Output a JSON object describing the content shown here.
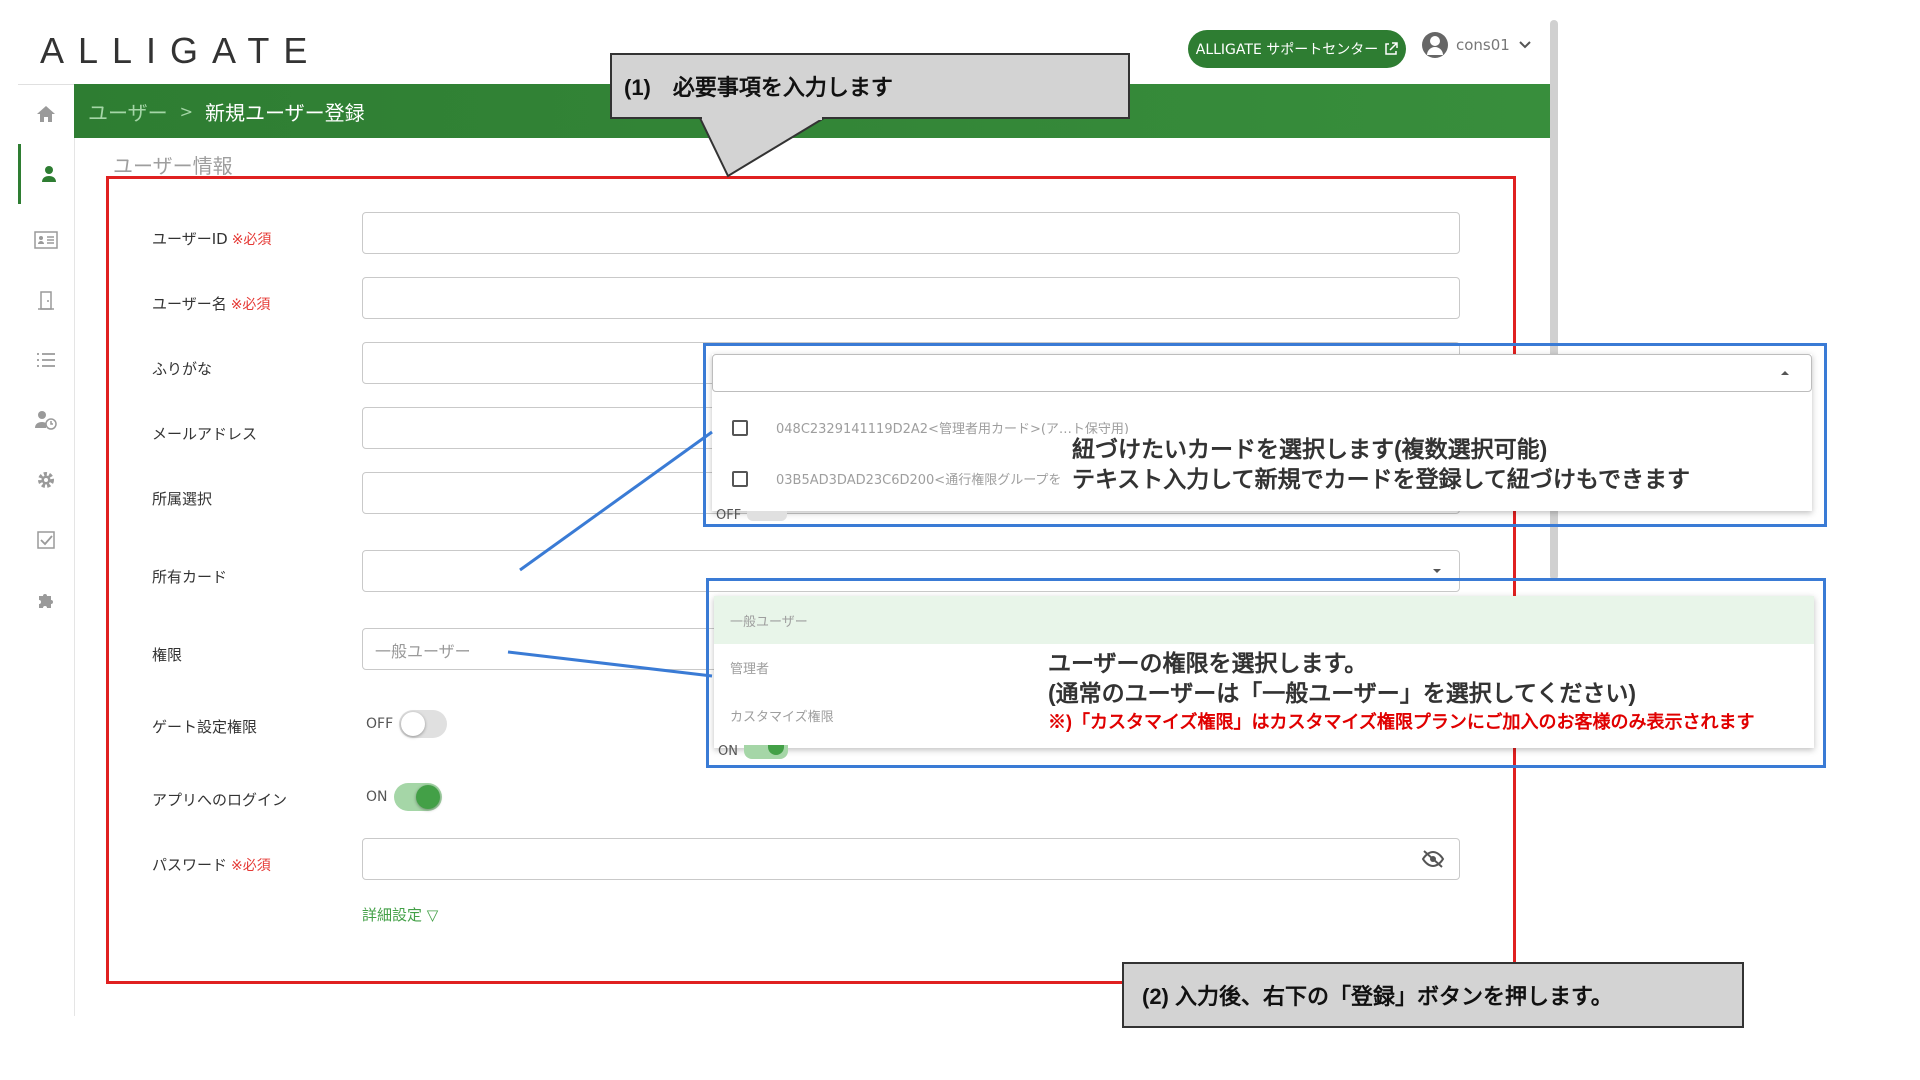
{
  "header": {
    "logo": "ALLIGATE",
    "support_label": "ALLIGATE サポートセンター",
    "user_name": "cons01"
  },
  "sidebar": {
    "items": [
      {
        "icon": "home-icon",
        "active": false
      },
      {
        "icon": "user-icon",
        "active": true
      },
      {
        "icon": "id-card-icon",
        "active": false
      },
      {
        "icon": "door-icon",
        "active": false
      },
      {
        "icon": "list-icon",
        "active": false
      },
      {
        "icon": "user-clock-icon",
        "active": false
      },
      {
        "icon": "gear-icon",
        "active": false
      },
      {
        "icon": "checkbox-icon",
        "active": false
      },
      {
        "icon": "puzzle-icon",
        "active": false
      }
    ]
  },
  "breadcrumb": {
    "parent": "ユーザー",
    "separator": ">",
    "current": "新規ユーザー登録"
  },
  "section_title": "ユーザー情報",
  "form": {
    "required_mark": "※必須",
    "user_id_label": "ユーザーID",
    "user_name_label": "ユーザー名",
    "furigana_label": "ふりがな",
    "email_label": "メールアドレス",
    "affiliation_label": "所属選択",
    "card_label": "所有カード",
    "role_label": "権限",
    "role_value": "一般ユーザー",
    "gate_label": "ゲート設定権限",
    "gate_state": "OFF",
    "app_login_label": "アプリへのログイン",
    "app_login_state": "ON",
    "password_label": "パスワード",
    "detail_link": "詳細設定 ▽"
  },
  "card_dropdown": {
    "options": [
      "048C2329141119D2A2<管理者用カード>(ア…ト保守用)",
      "03B5AD3DAD23C6D200<通行権限グループを"
    ],
    "peek_state": "OFF"
  },
  "role_dropdown": {
    "options": [
      "一般ユーザー",
      "管理者",
      "カスタマイズ権限"
    ],
    "peek_state": "ON"
  },
  "annotations": {
    "step1": "(1)　必要事項を入力します",
    "step2": "(2) 入力後、右下の「登録」ボタンを押します。",
    "card_line1": "紐づけたいカードを選択します(複数選択可能)",
    "card_line2": "テキスト入力して新規でカードを登録して紐づけもできます",
    "role_line1": "ユーザーの権限を選択します。",
    "role_line2": "(通常のユーザーは「一般ユーザー」を選択してください)",
    "role_note": "※)「カスタマイズ権限」はカスタマイズ権限プランにご加入のお客様のみ表示されます"
  },
  "colors": {
    "brand_green": "#2e7d32",
    "annotation_red": "#e02020",
    "annotation_blue": "#3a7bd5",
    "callout_gray": "#d3d3d3"
  }
}
